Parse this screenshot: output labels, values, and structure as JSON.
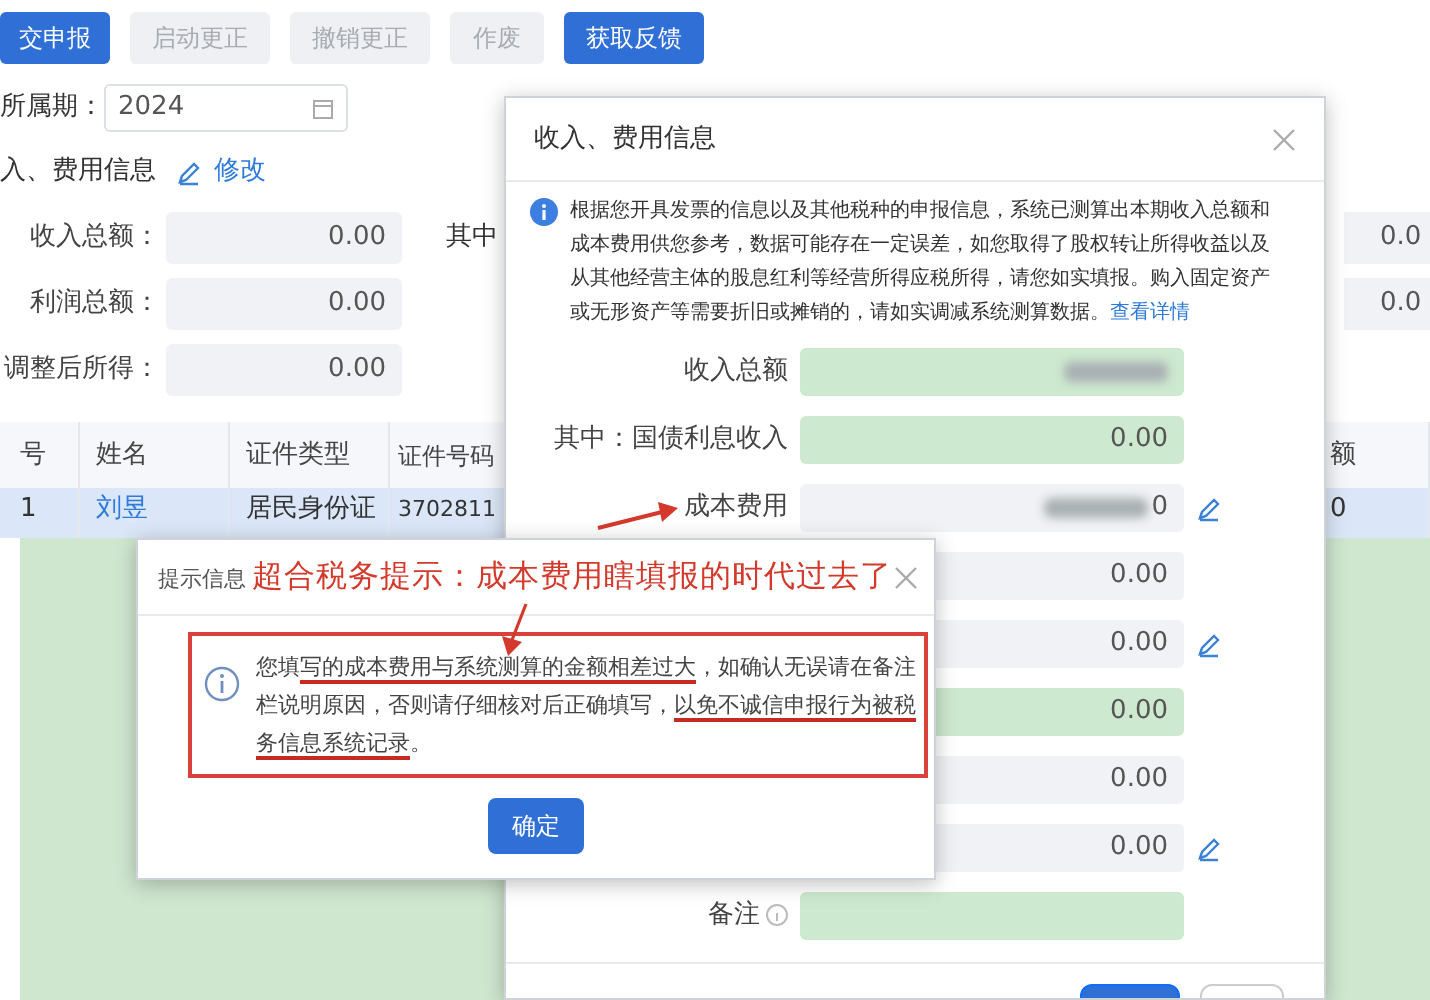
{
  "toolbar": {
    "buttons": [
      {
        "label": "交申报",
        "kind": "primary"
      },
      {
        "label": "启动更正",
        "kind": "disabled"
      },
      {
        "label": "撤销更正",
        "kind": "disabled"
      },
      {
        "label": "作废",
        "kind": "disabled"
      },
      {
        "label": "获取反馈",
        "kind": "primary"
      }
    ]
  },
  "period": {
    "label": "所属期：",
    "value": "2024"
  },
  "section": {
    "title": "入、费用信息",
    "action": "修改"
  },
  "summary_fields": [
    {
      "label": "收入总额：",
      "value": "0.00",
      "side_label": "其中",
      "right_value": "0.0"
    },
    {
      "label": "利润总额：",
      "value": "0.00",
      "right_value": "0.0"
    },
    {
      "label": "调整后所得：",
      "value": "0.00"
    }
  ],
  "table": {
    "columns": [
      "号",
      "姓名",
      "证件类型",
      "证件号码"
    ],
    "right_column": "额",
    "rows": [
      {
        "cells": [
          "1",
          "刘昱",
          "居民身份证",
          "3702811"
        ],
        "right_cell": "0",
        "selected": true
      }
    ]
  },
  "income_dialog": {
    "title": "收入、费用信息",
    "notice": "根据您开具发票的信息以及其他税种的申报信息，系统已测算出本期收入总额和成本费用供您参考，数据可能存在一定误差，如您取得了股权转让所得收益以及从其他经营主体的股息红利等经营所得应税所得，请您如实填报。购入固定资产或无形资产等需要折旧或摊销的，请如实调减系统测算数据。",
    "notice_link": "查看详情",
    "rows": [
      {
        "label": "收入总额",
        "redacted": true,
        "kind": "computed",
        "editable": false
      },
      {
        "label": "其中：国债利息收入",
        "value": "0.00",
        "redacted": false,
        "kind": "computed",
        "editable": false
      },
      {
        "label": "成本费用",
        "value": "0",
        "redacted": true,
        "kind": "manual",
        "editable": true
      },
      {
        "value": "0.00",
        "redacted": false,
        "kind": "manual",
        "editable": false
      },
      {
        "value": "0.00",
        "redacted": false,
        "kind": "manual",
        "editable": true
      },
      {
        "value": "0.00",
        "redacted": false,
        "kind": "computed",
        "editable": false
      },
      {
        "value": "0.00",
        "redacted": false,
        "kind": "manual",
        "editable": false
      },
      {
        "value": "0.00",
        "redacted": false,
        "kind": "manual",
        "editable": true
      },
      {
        "label": "备注",
        "redacted": false,
        "kind": "computed",
        "editable": false,
        "hint": true
      }
    ]
  },
  "alert_dialog": {
    "title": "提示信息",
    "annotation": "超合税务提示：成本费用瞎填报的时代过去了",
    "message": [
      {
        "text": "您填",
        "underlined": false
      },
      {
        "text": "写的成本费用与系统测算的金额相差过大",
        "underlined": true
      },
      {
        "text": "，如确认无误请在备注栏说明原因，否则请仔细核对后正确填写，",
        "underlined": false
      },
      {
        "text": "以免不诚信申报行为被税务信息系统记录",
        "underlined": true
      },
      {
        "text": "。",
        "underlined": false
      }
    ],
    "button": "确定"
  }
}
